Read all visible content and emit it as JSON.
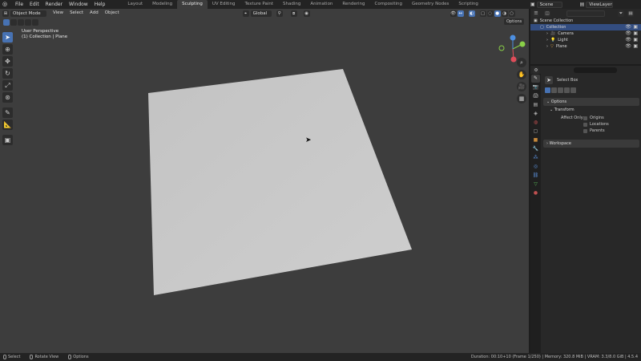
{
  "menu": [
    "File",
    "Edit",
    "Render",
    "Window",
    "Help"
  ],
  "workspaces": [
    {
      "label": "Layout",
      "active": false
    },
    {
      "label": "Modeling",
      "active": false
    },
    {
      "label": "Sculpting",
      "active": true
    },
    {
      "label": "UV Editing",
      "active": false
    },
    {
      "label": "Texture Paint",
      "active": false
    },
    {
      "label": "Shading",
      "active": false
    },
    {
      "label": "Animation",
      "active": false
    },
    {
      "label": "Rendering",
      "active": false
    },
    {
      "label": "Compositing",
      "active": false
    },
    {
      "label": "Geometry Nodes",
      "active": false
    },
    {
      "label": "Scripting",
      "active": false
    }
  ],
  "scene": {
    "name": "Scene",
    "view_layer": "ViewLayer"
  },
  "viewport": {
    "mode": "Object Mode",
    "menus": [
      "View",
      "Select",
      "Add",
      "Object"
    ],
    "transform_orientation": "Global",
    "perspective_label": "User Perspective",
    "collection_label": "(1) Collection | Plane",
    "options_label": "Options"
  },
  "outliner": {
    "search_placeholder": "",
    "rows": [
      {
        "label": "Scene Collection",
        "indent": 0,
        "icon": "scene-collection-icon"
      },
      {
        "label": "Collection",
        "indent": 1,
        "icon": "collection-icon"
      },
      {
        "label": "Camera",
        "indent": 2,
        "icon": "camera-icon"
      },
      {
        "label": "Light",
        "indent": 2,
        "icon": "light-icon"
      },
      {
        "label": "Plane",
        "indent": 2,
        "icon": "mesh-icon"
      }
    ]
  },
  "properties": {
    "search_placeholder": "",
    "active_tool": "Select Box",
    "options_panel": "Options",
    "transform_subpanel": "Transform",
    "affect_only_label": "Affect Only",
    "checkboxes": [
      "Origins",
      "Locations",
      "Parents"
    ],
    "workspace_panel": "Workspace"
  },
  "statusbar": {
    "left": [
      "Select",
      "Rotate View",
      "Options"
    ],
    "right": "Duration: 00:10+10 (Frame 1/250) | Memory: 320.8 MiB | VRAM: 3.3/8.0 GiB | 4.5.4"
  },
  "colors": {
    "accent": "#4772b3",
    "plane": "#c8c8c8",
    "viewport_bg": "#3d3d3d"
  }
}
